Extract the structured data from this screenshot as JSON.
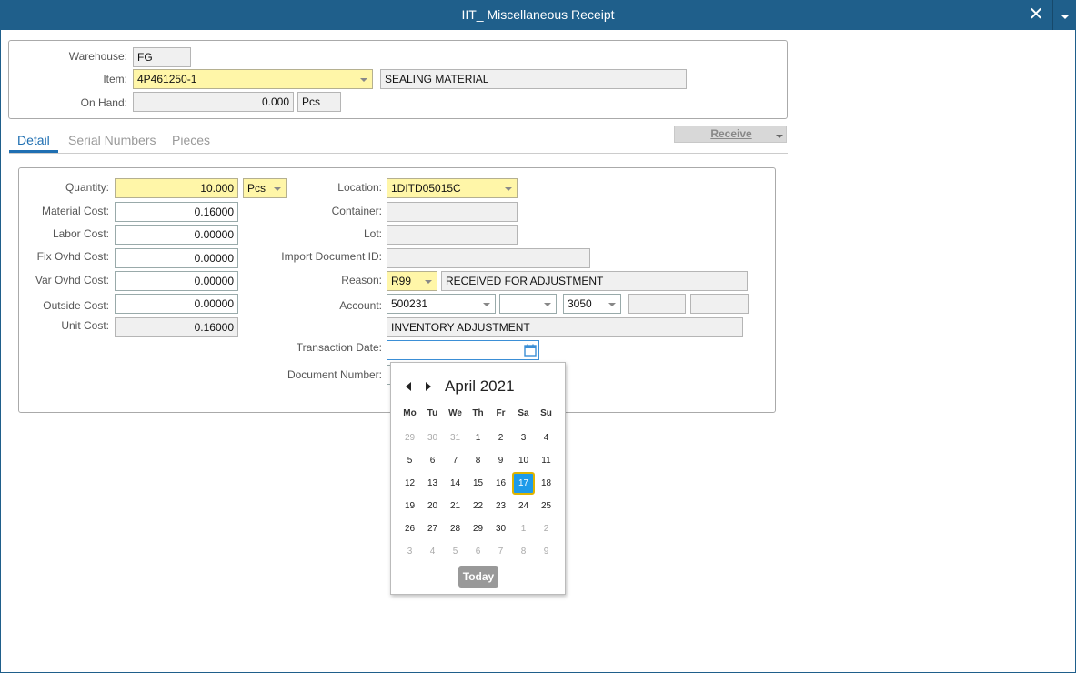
{
  "window": {
    "title": "IIT_ Miscellaneous Receipt",
    "close_glyph": "✕"
  },
  "header": {
    "warehouse_label": "Warehouse:",
    "warehouse_value": "FG",
    "item_label": "Item:",
    "item_value": "4P461250-1",
    "item_description": "SEALING MATERIAL",
    "onhand_label": "On Hand:",
    "onhand_value": "0.000",
    "onhand_unit": "Pcs"
  },
  "tabs": [
    {
      "label": "Detail",
      "active": true
    },
    {
      "label": "Serial Numbers",
      "active": false
    },
    {
      "label": "Pieces",
      "active": false
    }
  ],
  "receive_button": "Receive",
  "detail": {
    "quantity_label": "Quantity:",
    "quantity_value": "10.000",
    "quantity_unit": "Pcs",
    "material_cost_label": "Material Cost:",
    "material_cost_value": "0.16000",
    "labor_cost_label": "Labor Cost:",
    "labor_cost_value": "0.00000",
    "fix_ovhd_label": "Fix Ovhd Cost:",
    "fix_ovhd_value": "0.00000",
    "var_ovhd_label": "Var Ovhd Cost:",
    "var_ovhd_value": "0.00000",
    "outside_cost_label": "Outside Cost:",
    "outside_cost_value": "0.00000",
    "unit_cost_label": "Unit Cost:",
    "unit_cost_value": "0.16000",
    "location_label": "Location:",
    "location_value": "1DITD05015C",
    "container_label": "Container:",
    "container_value": "",
    "lot_label": "Lot:",
    "lot_value": "",
    "import_doc_label": "Import Document ID:",
    "import_doc_value": "",
    "reason_label": "Reason:",
    "reason_code": "R99",
    "reason_description": "RECEIVED FOR ADJUSTMENT",
    "account_label": "Account:",
    "account_1": "500231",
    "account_2": "",
    "account_3": "3050",
    "account_4": "",
    "account_5": "",
    "account_description": "INVENTORY ADJUSTMENT",
    "transaction_date_label": "Transaction Date:",
    "transaction_date_value": "",
    "document_number_label": "Document Number:",
    "document_number_value": ""
  },
  "calendar": {
    "month_title": "April 2021",
    "weekdays": [
      "Mo",
      "Tu",
      "We",
      "Th",
      "Fr",
      "Sa",
      "Su"
    ],
    "weeks": [
      [
        "29",
        "30",
        "31",
        "1",
        "2",
        "3",
        "4"
      ],
      [
        "5",
        "6",
        "7",
        "8",
        "9",
        "10",
        "11"
      ],
      [
        "12",
        "13",
        "14",
        "15",
        "16",
        "17",
        "18"
      ],
      [
        "19",
        "20",
        "21",
        "22",
        "23",
        "24",
        "25"
      ],
      [
        "26",
        "27",
        "28",
        "29",
        "30",
        "1",
        "2"
      ],
      [
        "3",
        "4",
        "5",
        "6",
        "7",
        "8",
        "9"
      ]
    ],
    "other_month": [
      [
        true,
        true,
        true,
        false,
        false,
        false,
        false
      ],
      [
        false,
        false,
        false,
        false,
        false,
        false,
        false
      ],
      [
        false,
        false,
        false,
        false,
        false,
        false,
        false
      ],
      [
        false,
        false,
        false,
        false,
        false,
        false,
        false
      ],
      [
        false,
        false,
        false,
        false,
        false,
        true,
        true
      ],
      [
        true,
        true,
        true,
        true,
        true,
        true,
        true
      ]
    ],
    "selected_day": "17",
    "today_label": "Today"
  },
  "colors": {
    "titlebar": "#1f5f8b",
    "required_field": "#fff6a8",
    "accent": "#1f6fb2",
    "selected_day": "#1e9be9"
  }
}
